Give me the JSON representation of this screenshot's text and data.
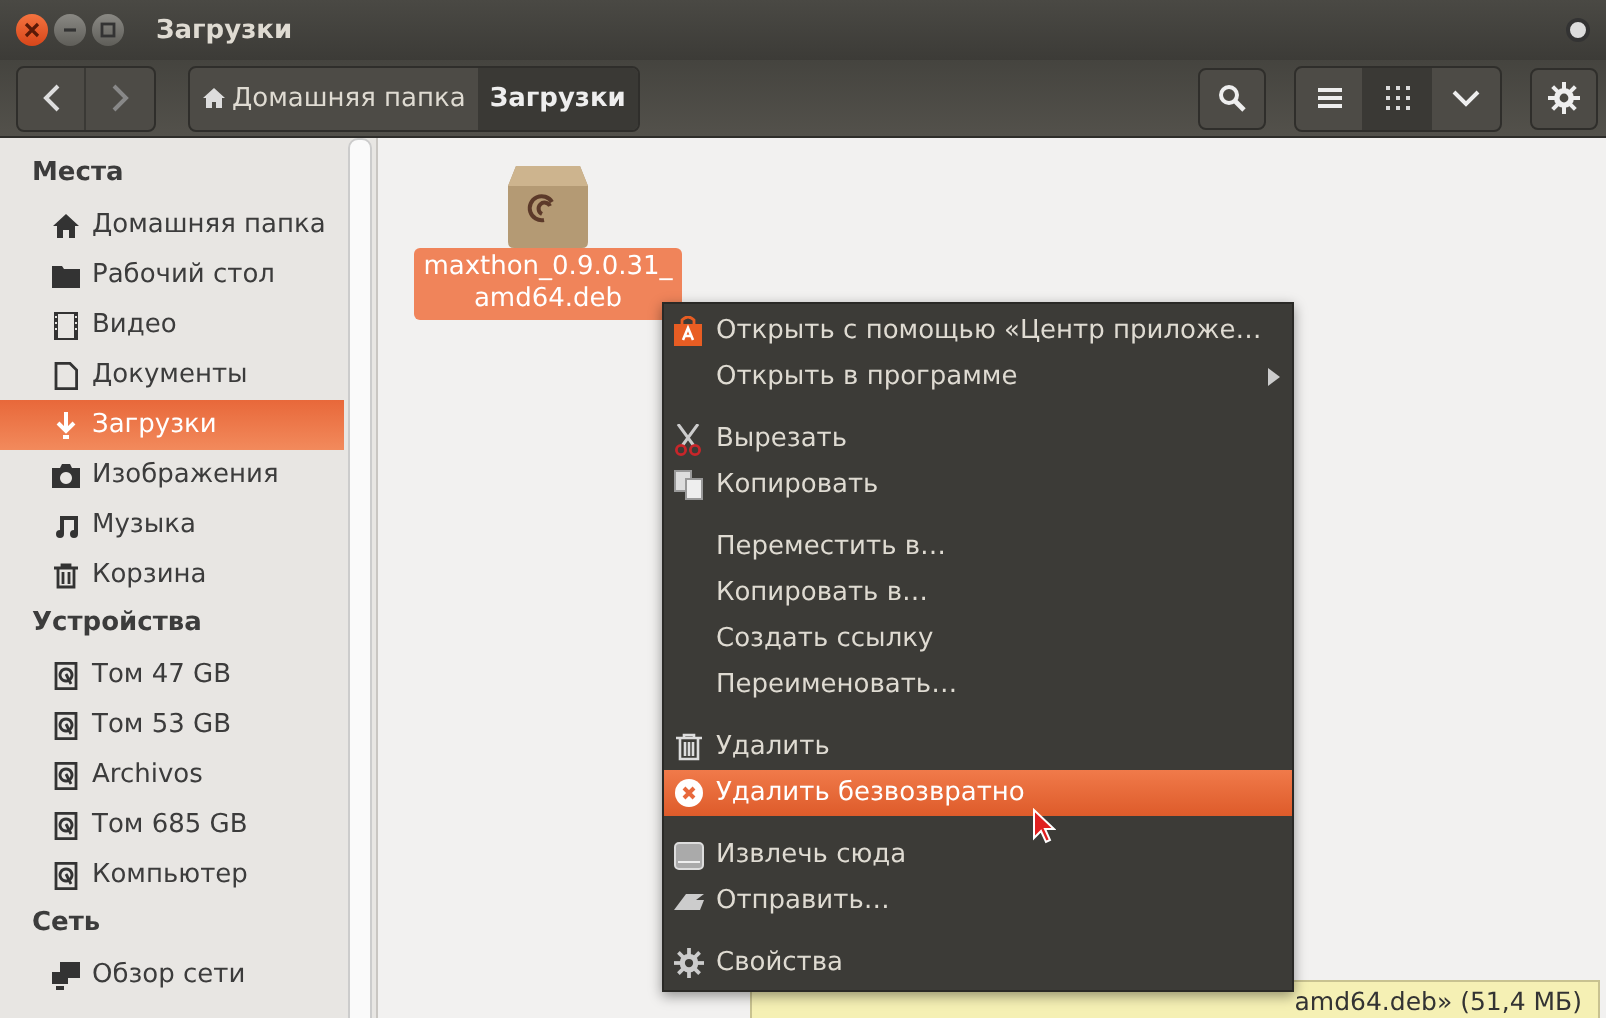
{
  "window": {
    "title": "Загрузки"
  },
  "toolbar": {
    "breadcrumbs": [
      {
        "label": "Домашняя папка",
        "selected": false
      },
      {
        "label": "Загрузки",
        "selected": true
      }
    ],
    "views": [
      {
        "kind": "list",
        "selected": false
      },
      {
        "kind": "grid",
        "selected": true
      },
      {
        "kind": "options",
        "selected": false
      }
    ]
  },
  "sidebar": [
    {
      "heading": "Места",
      "items": [
        {
          "label": "Домашняя папка",
          "selected": false
        },
        {
          "label": "Рабочий стол",
          "selected": false
        },
        {
          "label": "Видео",
          "selected": false
        },
        {
          "label": "Документы",
          "selected": false
        },
        {
          "label": "Загрузки",
          "selected": true
        },
        {
          "label": "Изображения",
          "selected": false
        },
        {
          "label": "Музыка",
          "selected": false
        },
        {
          "label": "Корзина",
          "selected": false
        }
      ]
    },
    {
      "heading": "Устройства",
      "items": [
        {
          "label": "Том 47 GB",
          "selected": false
        },
        {
          "label": "Том 53 GB",
          "selected": false
        },
        {
          "label": "Archivos",
          "selected": false
        },
        {
          "label": "Том 685 GB",
          "selected": false
        },
        {
          "label": "Компьютер",
          "selected": false
        }
      ]
    },
    {
      "heading": "Сеть",
      "items": [
        {
          "label": "Обзор сети",
          "selected": false
        }
      ]
    }
  ],
  "files": [
    {
      "name": "maxthon_0.9.0.31_ amd64.deb",
      "selected": true
    }
  ],
  "context_menu": [
    {
      "kind": "item",
      "label": "Открыть с помощью «Центр приложе…",
      "submenu": false,
      "selected": false
    },
    {
      "kind": "item",
      "label": "Открыть в программе",
      "submenu": true,
      "selected": false
    },
    {
      "kind": "separator"
    },
    {
      "kind": "item",
      "label": "Вырезать",
      "submenu": false,
      "selected": false
    },
    {
      "kind": "item",
      "label": "Копировать",
      "submenu": false,
      "selected": false
    },
    {
      "kind": "separator"
    },
    {
      "kind": "item",
      "label": "Переместить в…",
      "submenu": false,
      "selected": false
    },
    {
      "kind": "item",
      "label": "Копировать в…",
      "submenu": false,
      "selected": false
    },
    {
      "kind": "item",
      "label": "Создать ссылку",
      "submenu": false,
      "selected": false
    },
    {
      "kind": "item",
      "label": "Переименовать…",
      "submenu": false,
      "selected": false
    },
    {
      "kind": "separator"
    },
    {
      "kind": "item",
      "label": "Удалить",
      "submenu": false,
      "selected": false
    },
    {
      "kind": "item",
      "label": "Удалить безвозвратно",
      "submenu": false,
      "selected": true
    },
    {
      "kind": "separator"
    },
    {
      "kind": "item",
      "label": "Извлечь сюда",
      "submenu": false,
      "selected": false
    },
    {
      "kind": "item",
      "label": "Отправить…",
      "submenu": false,
      "selected": false
    },
    {
      "kind": "separator"
    },
    {
      "kind": "item",
      "label": "Свойства",
      "submenu": false,
      "selected": false
    }
  ],
  "status_bar": {
    "text": "amd64.deb» (51,4 МБ)"
  }
}
